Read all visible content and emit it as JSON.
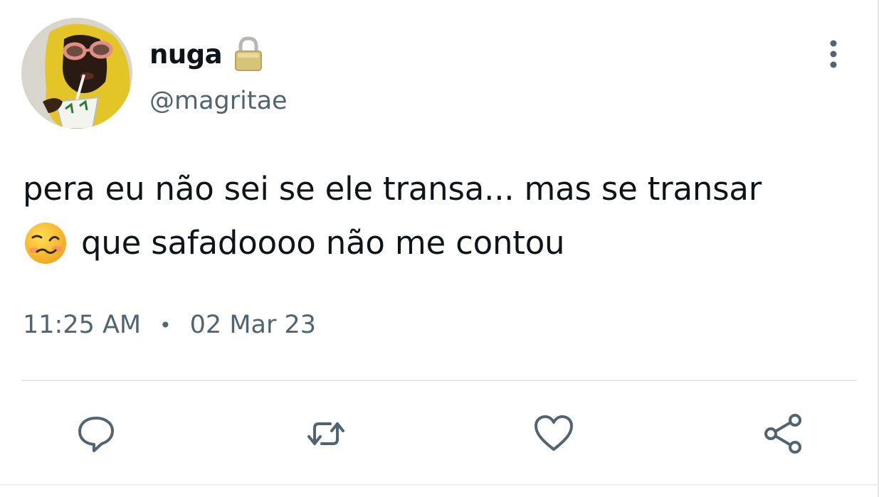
{
  "author": {
    "display_name": "nuga",
    "handle": "@magritae",
    "avatar_icon": "avatar-photo",
    "protected_icon": "lock-icon"
  },
  "tweet": {
    "text_line1": "pera eu não sei se ele transa... mas se transar",
    "text_line2": "que safadoooo não me contou",
    "emoji": "woozy-face-icon",
    "time": "11:25 AM",
    "separator": "•",
    "date": "02 Mar 23"
  },
  "actions": [
    {
      "name": "reply",
      "icon": "reply-icon"
    },
    {
      "name": "retweet",
      "icon": "retweet-icon"
    },
    {
      "name": "like",
      "icon": "heart-icon"
    },
    {
      "name": "share",
      "icon": "share-icon"
    }
  ],
  "colors": {
    "text_primary": "#0f1419",
    "text_secondary": "#536471",
    "divider": "#e6e9ec"
  }
}
